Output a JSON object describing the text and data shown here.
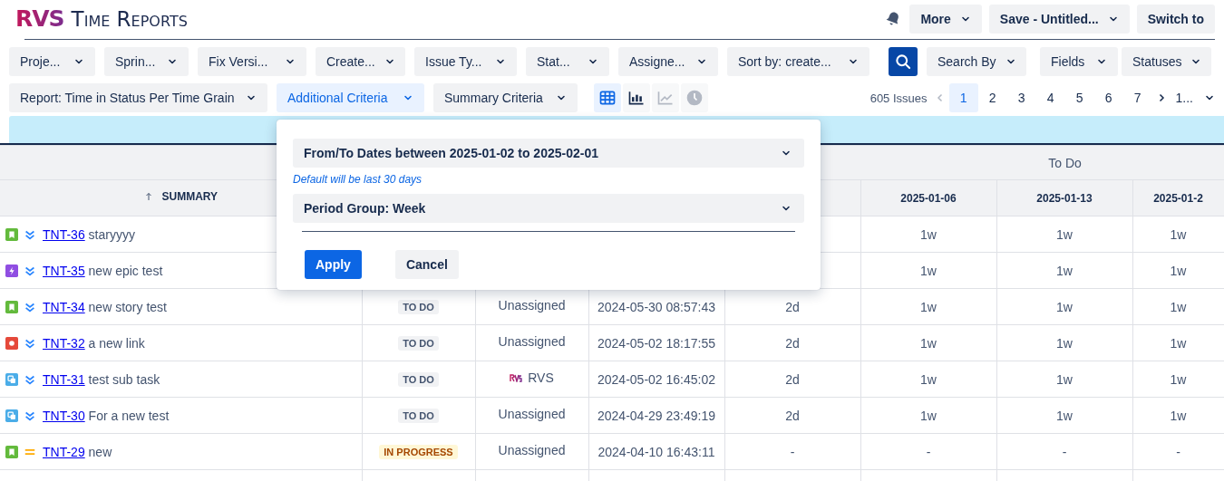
{
  "header": {
    "logo": "RVS",
    "title": "Time Reports",
    "buttons": [
      {
        "label": "More",
        "dropdown": true
      },
      {
        "label": "Save - Untitled...",
        "dropdown": true
      },
      {
        "label": "Switch to",
        "dropdown": false
      }
    ]
  },
  "filters": [
    "Proje...",
    "Sprin...",
    "Fix Versi...",
    "Create...",
    "Issue Ty...",
    "Stat...",
    "Assigne...",
    "Sort by: create..."
  ],
  "search_options": [
    "Search By",
    "Fields",
    "Statuses"
  ],
  "criteria": [
    {
      "label": "Report: Time in Status Per Time Grain",
      "selected": false
    },
    {
      "label": "Additional Criteria",
      "selected": true
    },
    {
      "label": "Summary Criteria",
      "selected": false
    }
  ],
  "views": [
    {
      "kind": "table",
      "selected": true,
      "disabled": false
    },
    {
      "kind": "bar",
      "selected": false,
      "disabled": false
    },
    {
      "kind": "line",
      "selected": false,
      "disabled": true
    },
    {
      "kind": "clock",
      "selected": false,
      "disabled": true
    }
  ],
  "pagination": {
    "count": "605 Issues",
    "prev_disabled": true,
    "pages": [
      {
        "label": "1",
        "selected": true
      },
      {
        "label": "2",
        "selected": false
      },
      {
        "label": "3",
        "selected": false
      },
      {
        "label": "4",
        "selected": false
      },
      {
        "label": "5",
        "selected": false
      },
      {
        "label": "6",
        "selected": false
      },
      {
        "label": "7",
        "selected": false
      }
    ],
    "more": "1..."
  },
  "popup": {
    "date_range": "From/To Dates between 2025-01-02 to 2025-02-01",
    "hint": "Default will be last 30 days",
    "period": "Period Group: Week",
    "buttons": [
      {
        "label": "Apply",
        "primary": true
      },
      {
        "label": "Cancel",
        "primary": false
      }
    ]
  },
  "table": {
    "group_header": "To Do",
    "summary_header": "SUMMARY",
    "sort_ascending": true,
    "date_columns": [
      "2025-01-06",
      "2025-01-13",
      "2025-01-2"
    ],
    "rows": [
      {
        "type": {
          "kind": "story"
        },
        "priority": {
          "kind": "lowest"
        },
        "key": "TNT-36",
        "summary": "staryyyy",
        "weeks": [
          "1w",
          "1w",
          "1w"
        ]
      },
      {
        "type": {
          "kind": "epic"
        },
        "priority": {
          "kind": "lowest"
        },
        "key": "TNT-35",
        "summary": "new epic test",
        "weeks": [
          "1w",
          "1w",
          "1w"
        ]
      },
      {
        "type": {
          "kind": "story"
        },
        "priority": {
          "kind": "lowest"
        },
        "key": "TNT-34",
        "summary": "new story test",
        "status": {
          "label": "TO DO",
          "kind": "todo"
        },
        "assignee": "Unassigned",
        "avatar": false,
        "created": "2024-05-30 08:57:43",
        "time": "2d",
        "weeks": [
          "1w",
          "1w",
          "1w"
        ]
      },
      {
        "type": {
          "kind": "bug"
        },
        "priority": {
          "kind": "lowest"
        },
        "key": "TNT-32",
        "summary": "a new link",
        "status": {
          "label": "TO DO",
          "kind": "todo"
        },
        "assignee": "Unassigned",
        "avatar": false,
        "created": "2024-05-02 18:17:55",
        "time": "2d",
        "weeks": [
          "1w",
          "1w",
          "1w"
        ]
      },
      {
        "type": {
          "kind": "subtask"
        },
        "priority": {
          "kind": "lowest"
        },
        "key": "TNT-31",
        "summary": "test sub task",
        "status": {
          "label": "TO DO",
          "kind": "todo"
        },
        "assignee": "RVS",
        "avatar": true,
        "created": "2024-05-02 16:45:02",
        "time": "2d",
        "weeks": [
          "1w",
          "1w",
          "1w"
        ]
      },
      {
        "type": {
          "kind": "subtask"
        },
        "priority": {
          "kind": "lowest"
        },
        "key": "TNT-30",
        "summary": "For a new test",
        "status": {
          "label": "TO DO",
          "kind": "todo"
        },
        "assignee": "Unassigned",
        "avatar": false,
        "created": "2024-04-29 23:49:19",
        "time": "2d",
        "weeks": [
          "1w",
          "1w",
          "1w"
        ]
      },
      {
        "type": {
          "kind": "story"
        },
        "priority": {
          "kind": "medium"
        },
        "key": "TNT-29",
        "summary": "new",
        "status": {
          "label": "IN PROGRESS",
          "kind": "inprogress"
        },
        "assignee": "Unassigned",
        "avatar": false,
        "created": "2024-04-10 16:43:11",
        "time": "-",
        "weeks": [
          "-",
          "-",
          "-"
        ]
      }
    ]
  }
}
